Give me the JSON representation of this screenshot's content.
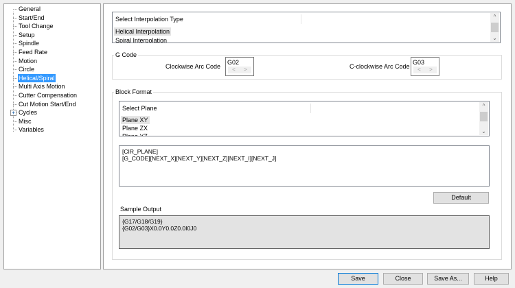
{
  "tree": {
    "items": [
      {
        "label": "General"
      },
      {
        "label": "Start/End"
      },
      {
        "label": "Tool Change"
      },
      {
        "label": "Setup"
      },
      {
        "label": "Spindle"
      },
      {
        "label": "Feed Rate"
      },
      {
        "label": "Motion"
      },
      {
        "label": "Circle"
      },
      {
        "label": "Helical/Spiral",
        "selected": true
      },
      {
        "label": "Multi Axis Motion"
      },
      {
        "label": "Cutter Compensation"
      },
      {
        "label": "Cut Motion Start/End"
      },
      {
        "label": "Cycles",
        "expandable": true
      },
      {
        "label": "Misc"
      },
      {
        "label": "Variables"
      }
    ]
  },
  "interpolation": {
    "header": "Select Interpolation Type",
    "items": [
      "Helical Interpolation",
      "Spiral Interpolation"
    ],
    "selected": "Helical Interpolation"
  },
  "gcode": {
    "title": "G Code",
    "cw_label": "Clockwise Arc Code",
    "cw_value": "G02",
    "ccw_label": "C-clockwise Arc Code",
    "ccw_value": "G03"
  },
  "block": {
    "title": "Block Format",
    "plane_header": "Select Plane",
    "planes": [
      "Plane XY",
      "Plane ZX",
      "Plane YZ"
    ],
    "selected": "Plane XY",
    "format_lines": [
      "[CIR_PLANE]",
      "[G_CODE][NEXT_X][NEXT_Y][NEXT_Z][NEXT_I][NEXT_J]"
    ],
    "default_label": "Default",
    "sample_label": "Sample Output",
    "sample_lines": [
      "{G17/G18/G19}",
      "{G02/G03}X0.0Y0.0Z0.0I0J0"
    ]
  },
  "footer": {
    "save": "Save",
    "close": "Close",
    "save_as": "Save As...",
    "help": "Help"
  }
}
